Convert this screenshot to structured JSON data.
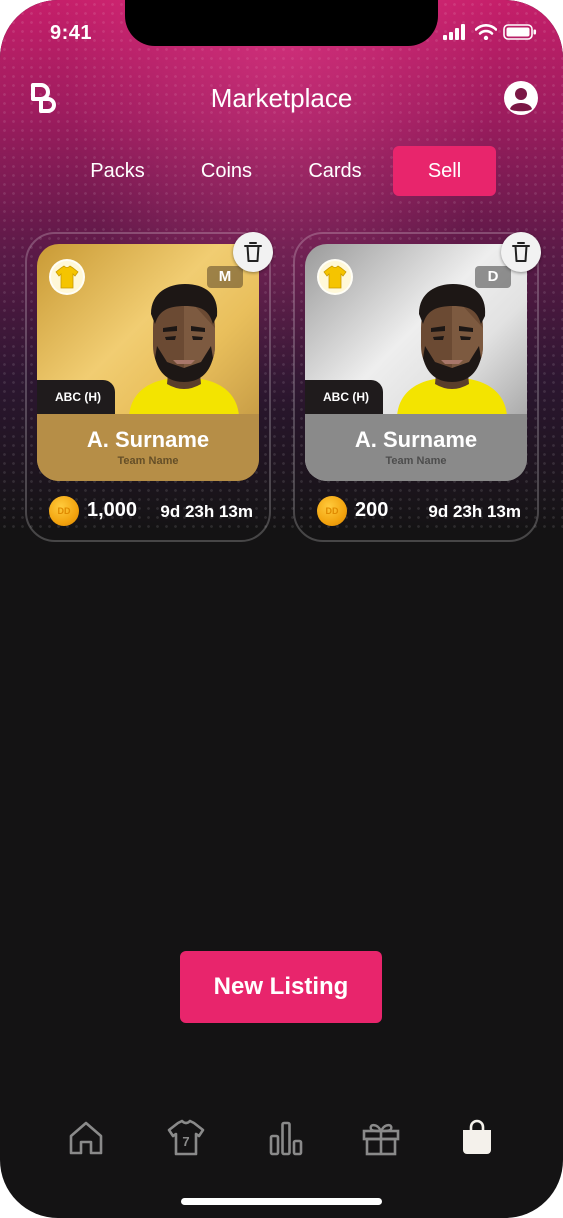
{
  "status_bar": {
    "time": "9:41"
  },
  "header": {
    "title": "Marketplace",
    "logo_icon": "db-logo-icon",
    "profile_icon": "user-circle-icon"
  },
  "tabs": [
    {
      "label": "Packs",
      "active": false
    },
    {
      "label": "Coins",
      "active": false
    },
    {
      "label": "Cards",
      "active": false
    },
    {
      "label": "Sell",
      "active": true
    }
  ],
  "listings": [
    {
      "tier": "gold",
      "rarity": "M",
      "position": "ABC (H)",
      "player_name": "A. Surname",
      "team_name": "Team Name",
      "coin_label": "DD",
      "price": "1,000",
      "time_left": "9d 23h 13m"
    },
    {
      "tier": "silver",
      "rarity": "D",
      "position": "ABC (H)",
      "player_name": "A. Surname",
      "team_name": "Team Name",
      "coin_label": "DD",
      "price": "200",
      "time_left": "9d 23h 13m"
    }
  ],
  "actions": {
    "new_listing": "New Listing"
  },
  "bottom_nav": [
    {
      "icon": "home-icon",
      "active": false
    },
    {
      "icon": "jersey-icon",
      "active": false,
      "badge": "7"
    },
    {
      "icon": "bar-chart-icon",
      "active": false
    },
    {
      "icon": "gift-icon",
      "active": false
    },
    {
      "icon": "shopping-bag-icon",
      "active": true
    }
  ],
  "colors": {
    "accent": "#e8256c",
    "background": "#141314",
    "gold": "#b68e47",
    "silver": "#8a8a8a"
  }
}
